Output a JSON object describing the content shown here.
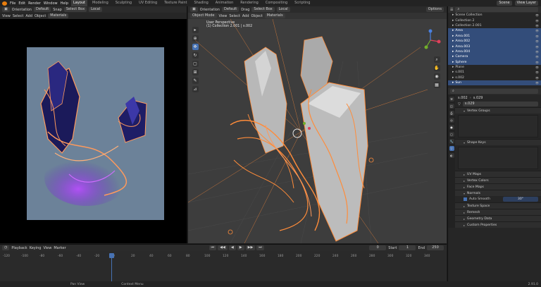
{
  "topbar": {
    "menus": [
      "File",
      "Edit",
      "Render",
      "Window",
      "Help"
    ],
    "workspaces": [
      "Layout",
      "Modeling",
      "Sculpting",
      "UV Editing",
      "Texture Paint",
      "Shading",
      "Animation",
      "Rendering",
      "Compositing",
      "Scripting"
    ],
    "active_workspace": "Layout",
    "scene": "Scene",
    "view_layer": "View Layer"
  },
  "left_header": {
    "orientation_label": "Orientation",
    "orientation_value": "Default",
    "snap": "Snap",
    "select": "Select Box",
    "local": "Local"
  },
  "left_subheader": {
    "items": [
      "View",
      "Select",
      "Add",
      "Object"
    ],
    "material": "Materials"
  },
  "vp_header": {
    "orientation_label": "Orientation",
    "orientation_value": "Default",
    "snap": "Drag",
    "select": "Select Box",
    "local": "Local",
    "options": "Options"
  },
  "vp_subheader": {
    "mode": "Object Mode",
    "items": [
      "View",
      "Select",
      "Add",
      "Object"
    ],
    "material": "Materials"
  },
  "vp_overlay": {
    "line1": "User Perspective",
    "line2": "(1) Collection 2.001 | s.002"
  },
  "outliner": {
    "rows": [
      {
        "label": "Scene Collection",
        "sel": false
      },
      {
        "label": "Collection 2",
        "sel": false
      },
      {
        "label": "Collection 2.001",
        "sel": false
      },
      {
        "label": "Area",
        "sel": true
      },
      {
        "label": "Area.001",
        "sel": true
      },
      {
        "label": "Area.002",
        "sel": true
      },
      {
        "label": "Area.003",
        "sel": true
      },
      {
        "label": "Area.004",
        "sel": true
      },
      {
        "label": "Camera",
        "sel": true
      },
      {
        "label": "Sphere",
        "sel": true
      },
      {
        "label": "Plane",
        "sel": false
      },
      {
        "label": "s.001",
        "sel": false
      },
      {
        "label": "s.002",
        "sel": false
      },
      {
        "label": "Sun",
        "sel": true
      }
    ]
  },
  "properties": {
    "object_name": "s.002",
    "mesh_name": "s.029",
    "data_name": "s.029",
    "panels": [
      "Vertex Groups",
      "Shape Keys",
      "UV Maps",
      "Vertex Colors",
      "Face Maps",
      "Normals",
      "Texture Space",
      "Remesh",
      "Geometry Data",
      "Custom Properties"
    ],
    "auto_smooth_label": "Auto Smooth",
    "auto_smooth_value": "30°"
  },
  "timeline": {
    "menus": [
      "Playback",
      "Keying",
      "View",
      "Marker"
    ],
    "current_frame": "0",
    "start_label": "Start",
    "start_value": "1",
    "end_label": "End",
    "end_value": "250",
    "ticks": [
      "-120",
      "-100",
      "-80",
      "-60",
      "-40",
      "-20",
      "0",
      "20",
      "40",
      "60",
      "80",
      "100",
      "120",
      "140",
      "160",
      "180",
      "200",
      "220",
      "240",
      "260",
      "280",
      "300",
      "320",
      "340"
    ]
  },
  "status": {
    "items": [
      "Pan View",
      "Context Menu"
    ],
    "version": "2.91.0"
  },
  "colors": {
    "accent": "#4772b3",
    "selection": "#334d7a",
    "wire": "#ff8c3a",
    "glow": "#ff9a5c"
  }
}
